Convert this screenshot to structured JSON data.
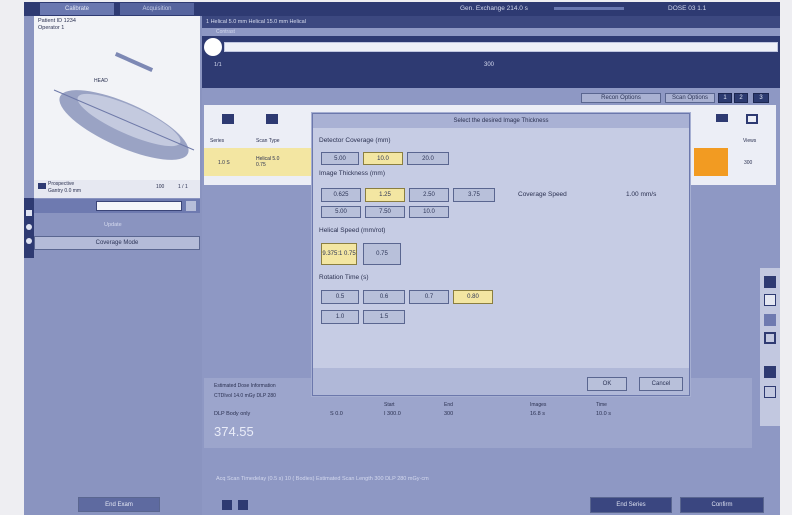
{
  "tabs": [
    "Calibrate",
    "Acquisition"
  ],
  "top_status": [
    "Gen. Exchange 214.0 s",
    "DOSE 03 1.1"
  ],
  "patient": {
    "line1": "Patient ID 1234",
    "line2": "Operator 1"
  },
  "thumbnail": {
    "label": "HEAD",
    "meta1": "Prospective",
    "meta2": "Gantry 0.0 mm",
    "zoom": "100",
    "page": "1 / 1"
  },
  "left": {
    "search_value": "",
    "link": "Update",
    "coverage_btn": "Coverage Mode",
    "end_exam": "End Exam"
  },
  "protocol_bar": {
    "title": "1 Helical 5.0 mm Helical  15.0 mm  Helical",
    "sub": "Contrast"
  },
  "series_number": "300",
  "timeline_label": "1/1",
  "toolbar": {
    "btn1": "Recon Options",
    "btn2": "Scan Options",
    "mini": [
      "1",
      "2",
      "3"
    ]
  },
  "grid": {
    "col1": "Series",
    "col2": "Scan Type",
    "row_val1": "1.0 S",
    "row_val2": "Helical 5.0 0.75",
    "right_col": "Views",
    "right_val": "300"
  },
  "dialog": {
    "title": "Select the desired Image Thickness",
    "sec1": "Detector Coverage (mm)",
    "sec1_opts": [
      "5.00",
      "10.0",
      "20.0"
    ],
    "sec2": "Image Thickness (mm)",
    "sec2_opts": [
      "0.625",
      "1.25",
      "2.50",
      "3.75",
      "5.00",
      "7.50",
      "10.0"
    ],
    "coverage_label": "Coverage Speed",
    "coverage_value": "1.00 mm/s",
    "sec3": "Helical Speed (mm/rot)",
    "sec3_opts": [
      "9.375:1 0.75",
      "0.75"
    ],
    "sec4": "Rotation Time (s)",
    "sec4_opts": [
      "0.5",
      "0.6",
      "0.7",
      "0.80",
      "1.0",
      "1.5"
    ],
    "ok": "OK",
    "cancel": "Cancel"
  },
  "scan_info": {
    "line1": "Estimated Dose Information",
    "line2": "CTDIvol 14.0 mGy DLP 280",
    "cols": [
      "Start",
      "End",
      "Images",
      "Time",
      "Delay"
    ],
    "vals": [
      "S 0.0",
      "I 300.0",
      "300",
      "16.8 s",
      "10.0 s"
    ],
    "dlp_label": "DLP  Body only",
    "dlp_value": "374.55"
  },
  "bottom_bar": "Acq Scan Timedelay (0.5 s)     10 ( Bodies)     Estimated Scan Length 300    DLP  280 mGy·cm",
  "footer": {
    "end_series": "End Series",
    "confirm": "Confirm"
  },
  "colors": {
    "nav": "#2e3a72",
    "panel": "#8590bc",
    "dialog": "#c6cce4",
    "selected": "#f3e6a2",
    "accent": "#f29b22"
  }
}
